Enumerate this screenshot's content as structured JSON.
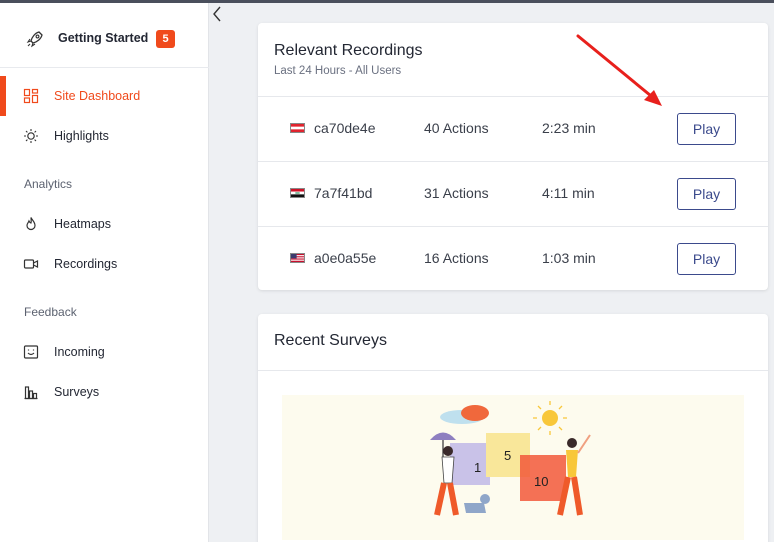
{
  "sidebar": {
    "getting_started": {
      "label": "Getting Started",
      "badge": "5"
    },
    "items_top": [
      {
        "label": "Site Dashboard",
        "icon": "dashboard-icon",
        "active": true
      },
      {
        "label": "Highlights",
        "icon": "sun-icon"
      }
    ],
    "analytics": {
      "heading": "Analytics",
      "items": [
        {
          "label": "Heatmaps",
          "icon": "flame-icon"
        },
        {
          "label": "Recordings",
          "icon": "video-camera-icon"
        }
      ]
    },
    "feedback": {
      "heading": "Feedback",
      "items": [
        {
          "label": "Incoming",
          "icon": "smiley-inbox-icon"
        },
        {
          "label": "Surveys",
          "icon": "bar-chart-icon"
        }
      ]
    }
  },
  "recordings": {
    "title": "Relevant Recordings",
    "subtitle": "Last 24 Hours - All Users",
    "rows": [
      {
        "id": "ca70de4e",
        "flag": "austria-flag-icon",
        "actions": "40 Actions",
        "duration": "2:23 min",
        "button": "Play"
      },
      {
        "id": "7a7f41bd",
        "flag": "iraq-flag-icon",
        "actions": "31 Actions",
        "duration": "4:11 min",
        "button": "Play"
      },
      {
        "id": "a0e0a55e",
        "flag": "us-flag-icon",
        "actions": "16 Actions",
        "duration": "1:03 min",
        "button": "Play"
      }
    ]
  },
  "surveys": {
    "title": "Recent Surveys",
    "illustration_numbers": [
      "1",
      "5",
      "10"
    ]
  },
  "colors": {
    "accent": "#f04a1c",
    "button": "#3b4a8c",
    "arrow": "#e8201c"
  }
}
